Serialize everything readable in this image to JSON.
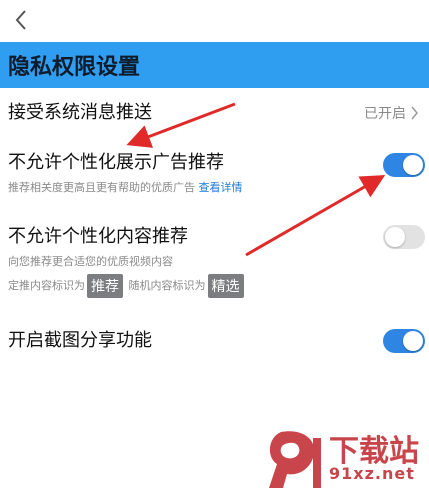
{
  "page": {
    "title": "隐私权限设置",
    "accent_color": "#2f9ef0"
  },
  "settings": {
    "system_push": {
      "label": "接受系统消息推送",
      "status": "已开启"
    },
    "ad_personalization": {
      "label": "不允许个性化展示广告推荐",
      "description": "推荐相关度更高且更有帮助的优质广告",
      "link": "查看详情",
      "enabled": true
    },
    "content_personalization": {
      "label": "不允许个性化内容推荐",
      "description": "向您推荐更合适您的优质视频内容",
      "tag_prefix_1": "定推内容标识为",
      "tag_1": "推荐",
      "tag_prefix_2": "随机内容标识为",
      "tag_2": "精选",
      "enabled": false
    },
    "screenshot_share": {
      "label": "开启截图分享功能",
      "enabled": true
    }
  },
  "icons": {
    "back": "chevron-left-icon",
    "status_arrow": "chevron-right-icon"
  },
  "watermark": {
    "line1": "下载站",
    "line2": "91xz.net"
  }
}
